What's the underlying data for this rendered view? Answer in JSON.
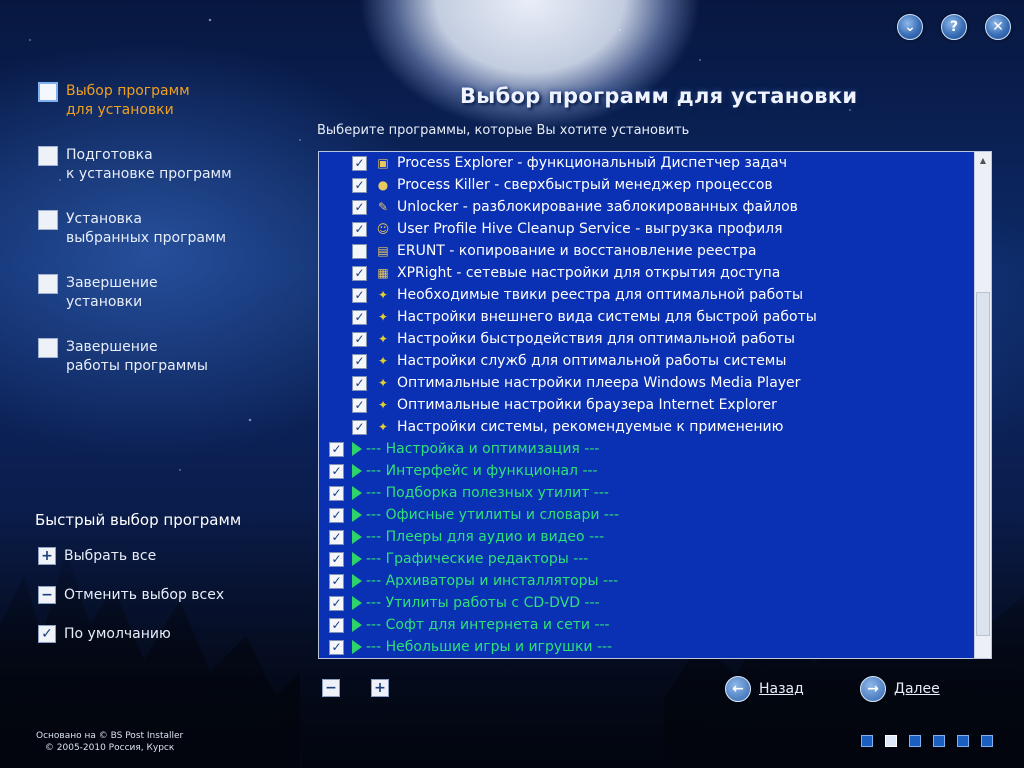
{
  "window_controls": {
    "minimize": "⌄",
    "help": "?",
    "close": "✕"
  },
  "steps": [
    {
      "label": "Выбор программ\nдля установки",
      "active": true
    },
    {
      "label": "Подготовка\nк установке программ",
      "active": false
    },
    {
      "label": "Установка\nвыбранных программ",
      "active": false
    },
    {
      "label": "Завершение\nустановки",
      "active": false
    },
    {
      "label": "Завершение\nработы программы",
      "active": false
    }
  ],
  "quick": {
    "title": "Быстрый выбор программ",
    "select_all": "Выбрать все",
    "deselect_all": "Отменить выбор всех",
    "default": "По умолчанию"
  },
  "credits": {
    "line1": "Основано на © BS Post Installer",
    "line2": "© 2005-2010 Россия, Курск"
  },
  "page_title": "Выбор программ для установки",
  "subtitle": "Выберите программы, которые Вы хотите установить",
  "items": [
    {
      "kind": "sub",
      "checked": true,
      "icon": "process-explorer-icon",
      "label": "Process Explorer - функциональный Диспетчер задач"
    },
    {
      "kind": "sub",
      "checked": true,
      "icon": "process-killer-icon",
      "label": "Process Killer - сверхбыстрый менеджер процессов"
    },
    {
      "kind": "sub",
      "checked": true,
      "icon": "unlocker-icon",
      "label": "Unlocker - разблокирование заблокированных файлов"
    },
    {
      "kind": "sub",
      "checked": true,
      "icon": "users-icon",
      "label": "User Profile Hive Cleanup Service - выгрузка профиля"
    },
    {
      "kind": "sub",
      "checked": false,
      "icon": "registry-icon",
      "label": "ERUNT  -  копирование и восстановление реестра"
    },
    {
      "kind": "sub",
      "checked": true,
      "icon": "network-icon",
      "label": "XPRight - сетевые настройки для открытия доступа"
    },
    {
      "kind": "sub",
      "checked": true,
      "icon": "tweak-icon",
      "label": "Необходимые твики реестра для оптимальной работы"
    },
    {
      "kind": "sub",
      "checked": true,
      "icon": "tweak-icon",
      "label": "Настройки внешнего вида системы для быстрой работы"
    },
    {
      "kind": "sub",
      "checked": true,
      "icon": "tweak-icon",
      "label": "Настройки быстродействия для оптимальной работы"
    },
    {
      "kind": "sub",
      "checked": true,
      "icon": "tweak-icon",
      "label": "Настройки служб для оптимальной работы системы"
    },
    {
      "kind": "sub",
      "checked": true,
      "icon": "tweak-icon",
      "label": "Оптимальные настройки плеера Windows Media Player"
    },
    {
      "kind": "sub",
      "checked": true,
      "icon": "tweak-icon",
      "label": "Оптимальные настройки браузера Internet Explorer"
    },
    {
      "kind": "sub",
      "checked": true,
      "icon": "tweak-icon",
      "label": "Настройки системы, рекомендуемые к применению"
    },
    {
      "kind": "cat",
      "checked": true,
      "label": "--- Настройка и оптимизация ---"
    },
    {
      "kind": "cat",
      "checked": true,
      "label": "--- Интерфейс и функционал ---"
    },
    {
      "kind": "cat",
      "checked": true,
      "label": "--- Подборка полезных утилит ---"
    },
    {
      "kind": "cat",
      "checked": true,
      "label": "--- Офисные утилиты и словари ---"
    },
    {
      "kind": "cat",
      "checked": true,
      "label": "--- Плееры для аудио и видео ---"
    },
    {
      "kind": "cat",
      "checked": true,
      "label": "--- Графические редакторы ---"
    },
    {
      "kind": "cat",
      "checked": true,
      "label": "--- Архиваторы и инсталляторы ---"
    },
    {
      "kind": "cat",
      "checked": true,
      "label": "--- Утилиты работы с CD-DVD ---"
    },
    {
      "kind": "cat",
      "checked": true,
      "label": "--- Софт для интернета и сети ---"
    },
    {
      "kind": "cat",
      "checked": true,
      "label": "--- Небольшие игры и игрушки ---"
    }
  ],
  "collapse_btn": "−",
  "expand_btn": "+",
  "nav": {
    "back": "Назад",
    "next": "Далее"
  },
  "progress": {
    "total_steps": 6,
    "current_step": 2
  }
}
